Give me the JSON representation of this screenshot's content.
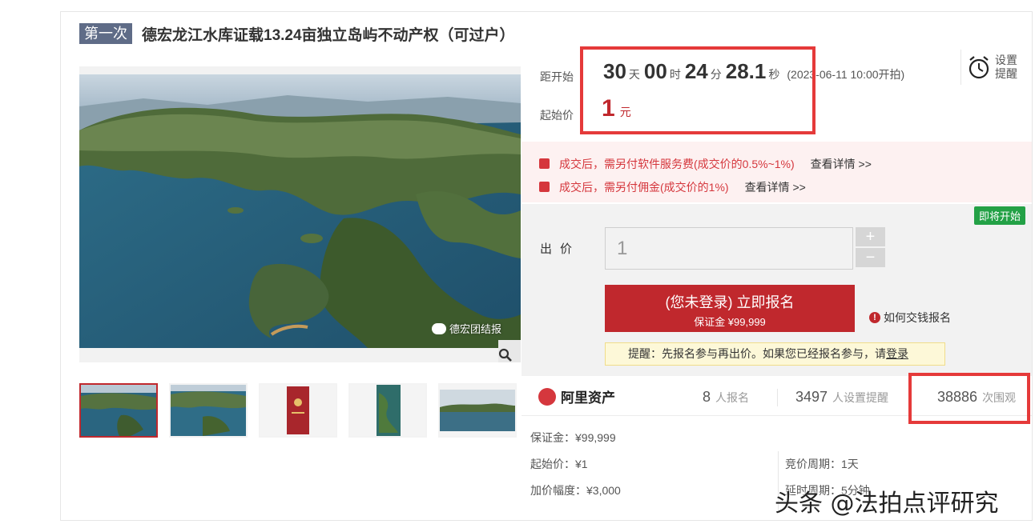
{
  "title": {
    "round_badge": "第一次",
    "text": "德宏龙江水库证载13.24亩独立岛屿不动产权（可过户）"
  },
  "gallery": {
    "watermark": "德宏团结报",
    "thumbnails": [
      "aerial-lake-1",
      "aerial-lake-2",
      "certificate",
      "aerial-vertical",
      "lake-panorama"
    ]
  },
  "countdown": {
    "label": "距开始",
    "days": "30",
    "days_unit": "天",
    "hours": "00",
    "hours_unit": "时",
    "minutes": "24",
    "minutes_unit": "分",
    "seconds": "28.1",
    "seconds_unit": "秒",
    "start_time": "(2023-06-11 10:00开拍)"
  },
  "start_price": {
    "label": "起始价",
    "value": "1",
    "unit": "元"
  },
  "remind": {
    "label_line1": "设置",
    "label_line2": "提醒"
  },
  "fees": [
    {
      "text": "成交后，需另付软件服务费(成交价的0.5%~1%)",
      "link": "查看详情 >>"
    },
    {
      "text": "成交后，需另付佣金(成交价的1%)",
      "link": "查看详情 >>"
    }
  ],
  "bid": {
    "status_badge": "即将开始",
    "label": "出价",
    "input_value": "1",
    "plus": "+",
    "minus": "−",
    "signup_main": "(您未登录) 立即报名",
    "signup_sub": "保证金 ¥99,999",
    "how_link": "如何交钱报名",
    "hint_prefix": "提醒：先报名参与再出价。如果您已经报名参与，请",
    "hint_login": "登录"
  },
  "stats": {
    "brand": "阿里资产",
    "registered_count": "8",
    "registered_label": "人报名",
    "reminder_count": "3497",
    "reminder_label": "人设置提醒",
    "views_count": "38886",
    "views_label": "次围观"
  },
  "details": {
    "deposit": "保证金：¥99,999",
    "start_price": "起始价：¥1",
    "increment": "加价幅度：¥3,000",
    "cycle": "竞价周期：1天",
    "delay": "延时周期：5分钟"
  },
  "brand_watermark": "头条 @法拍点评研究",
  "colors": {
    "accent_red": "#c0282d",
    "highlight_box": "#e53a3a",
    "badge_green": "#23a146",
    "round_badge": "#5f6c87"
  }
}
